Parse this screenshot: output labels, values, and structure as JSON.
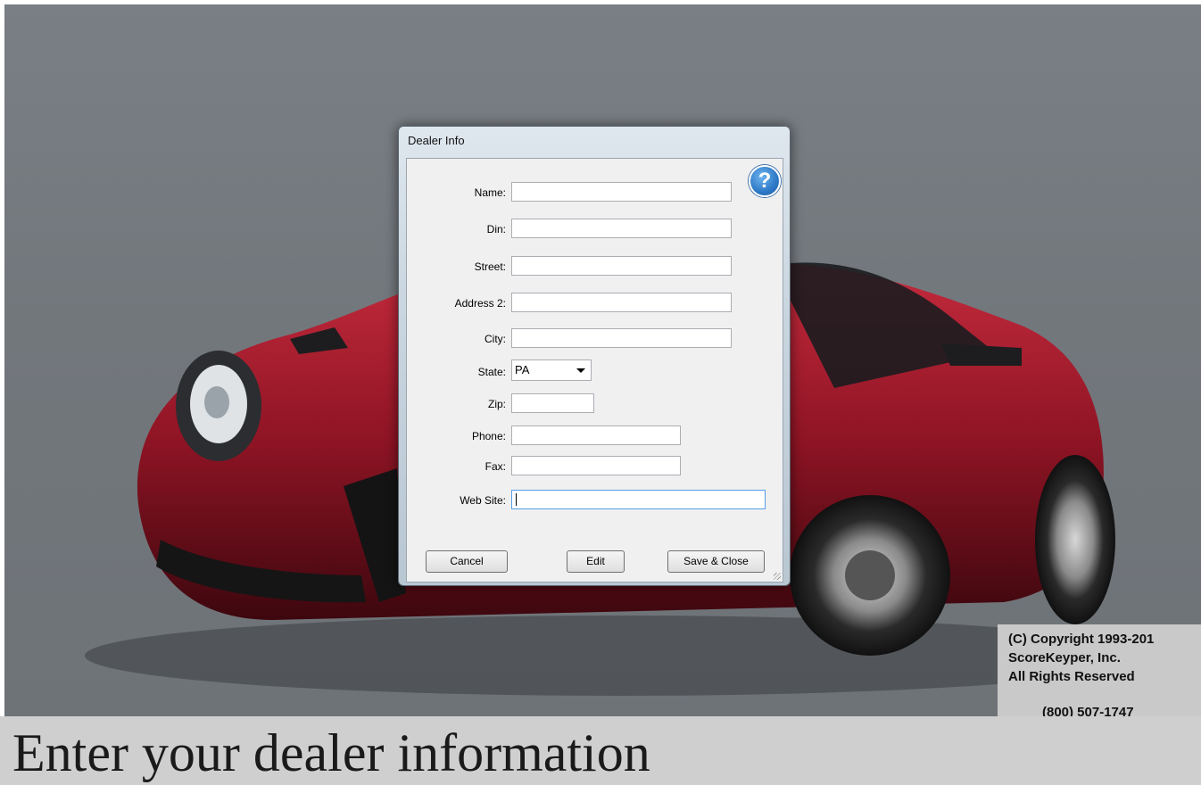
{
  "dialog": {
    "title": "Dealer Info",
    "help_icon": "help-question-icon",
    "help_glyph": "?",
    "fields": {
      "name": {
        "label": "Name:",
        "value": ""
      },
      "din": {
        "label": "Din:",
        "value": ""
      },
      "street": {
        "label": "Street:",
        "value": ""
      },
      "address2": {
        "label": "Address 2:",
        "value": ""
      },
      "city": {
        "label": "City:",
        "value": ""
      },
      "state": {
        "label": "State:",
        "value": "PA"
      },
      "zip": {
        "label": "Zip:",
        "value": ""
      },
      "phone": {
        "label": "Phone:",
        "value": ""
      },
      "fax": {
        "label": "Fax:",
        "value": ""
      },
      "website": {
        "label": "Web Site:",
        "value": ""
      }
    },
    "buttons": {
      "cancel": "Cancel",
      "edit": "Edit",
      "save_close": "Save & Close"
    }
  },
  "copyright": {
    "line1": "(C) Copyright 1993-201",
    "line2": "ScoreKeyper, Inc.",
    "line3": "All Rights Reserved",
    "line4": "(800) 507-1747"
  },
  "caption": "Enter your dealer information",
  "colors": {
    "car_red": "#8e1424",
    "background_gray": "#72777c",
    "help_blue": "#2d79c7"
  }
}
